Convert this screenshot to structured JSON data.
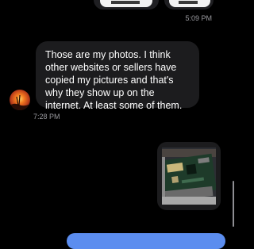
{
  "conversation": {
    "previous_timestamp": "5:09 PM",
    "incoming_message": {
      "text": "Those are my photos. I think other websites or sellers have copied my pictures and that's why they show up on the internet. At least some of them.",
      "timestamp": "7:28 PM"
    }
  },
  "colors": {
    "background": "#000000",
    "incoming_bubble": "#1c1c1e",
    "timestamp": "#9a9a9f",
    "accent": "#5b8def"
  }
}
